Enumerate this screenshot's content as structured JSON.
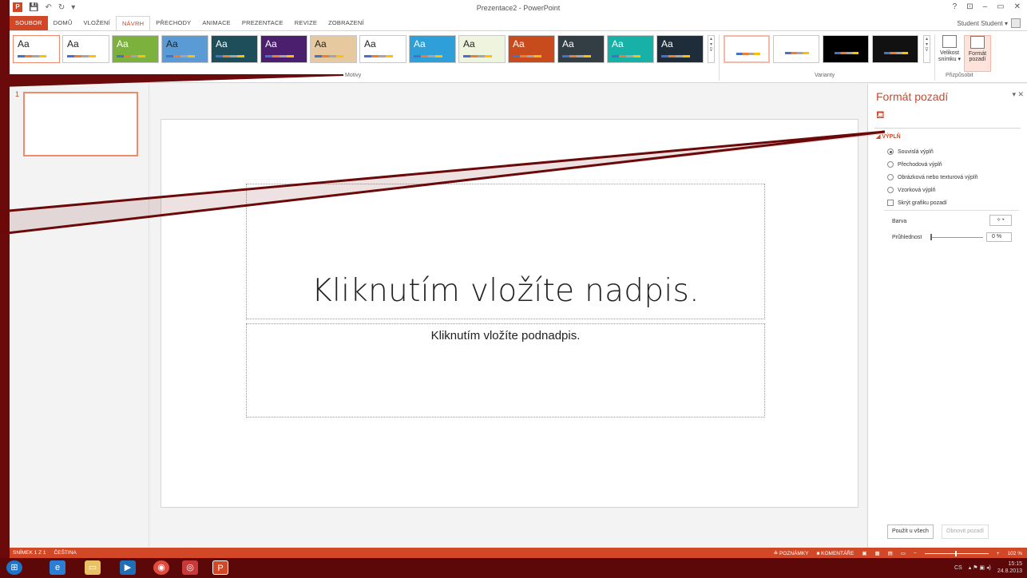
{
  "window": {
    "title": "Prezentace2 - PowerPoint",
    "controls": [
      "?",
      "⊡",
      "–",
      "▭",
      "✕"
    ],
    "qat": [
      "💾",
      "↶",
      "↻",
      "▾"
    ]
  },
  "tabs": [
    {
      "label": "SOUBOR"
    },
    {
      "label": "DOMŮ"
    },
    {
      "label": "VLOŽENÍ"
    },
    {
      "label": "NÁVRH"
    },
    {
      "label": "PŘECHODY"
    },
    {
      "label": "ANIMACE"
    },
    {
      "label": "PREZENTACE"
    },
    {
      "label": "REVIZE"
    },
    {
      "label": "ZOBRAZENÍ"
    }
  ],
  "user": {
    "name": "Student Student ▾"
  },
  "ribbon": {
    "themes_label": "Motivy",
    "variants_label": "Varianty",
    "customize_label": "Přizpůsobit",
    "themes": [
      {
        "aa": "Aa",
        "bg": "#ffffff",
        "fg": "#222222",
        "sel": true
      },
      {
        "aa": "Aa",
        "bg": "#ffffff",
        "fg": "#222222"
      },
      {
        "aa": "Aa",
        "bg": "#7bb13c",
        "fg": "#ffffff"
      },
      {
        "aa": "Aa",
        "bg": "#5b9bd5",
        "fg": "#222222"
      },
      {
        "aa": "Aa",
        "bg": "#1e4e5a",
        "fg": "#ffffff"
      },
      {
        "aa": "Aa",
        "bg": "#4b1f6e",
        "fg": "#ffffff"
      },
      {
        "aa": "Aa",
        "bg": "#e7c9a0",
        "fg": "#222222"
      },
      {
        "aa": "Aa",
        "bg": "#ffffff",
        "fg": "#222222"
      },
      {
        "aa": "Aa",
        "bg": "#2e9fd8",
        "fg": "#ffffff"
      },
      {
        "aa": "Aa",
        "bg": "#eef4de",
        "fg": "#222222"
      },
      {
        "aa": "Aa",
        "bg": "#c84b1e",
        "fg": "#ffffff"
      },
      {
        "aa": "Aa",
        "bg": "#333d44",
        "fg": "#ffffff"
      },
      {
        "aa": "Aa",
        "bg": "#17b1a8",
        "fg": "#ffffff"
      },
      {
        "aa": "Aa",
        "bg": "#1f2d3a",
        "fg": "#ffffff"
      }
    ],
    "variants": [
      {
        "bg": "#ffffff",
        "sel": true
      },
      {
        "bg": "#ffffff"
      },
      {
        "bg": "#000000"
      },
      {
        "bg": "#111111"
      }
    ],
    "slide_size": {
      "line1": "Velikost",
      "line2": "snímku ▾"
    },
    "format_bg": {
      "line1": "Formát",
      "line2": "pozadí"
    }
  },
  "thumbs": {
    "number": "1"
  },
  "slide": {
    "title_placeholder": "Kliknutím vložíte nadpis.",
    "subtitle_placeholder": "Kliknutím vložíte podnadpis."
  },
  "pane": {
    "title": "Formát pozadí",
    "ctrl": "▾ ✕",
    "section": "◢ VÝPLŇ",
    "options": [
      {
        "label": "Souvislá výplň",
        "checked": true
      },
      {
        "label": "Přechodová výplň",
        "checked": false
      },
      {
        "label": "Obrázková nebo texturová výplň",
        "checked": false
      },
      {
        "label": "Vzorková výplň",
        "checked": false
      }
    ],
    "hide_graphics": "Skrýt grafiku pozadí",
    "color_label": "Barva",
    "color_btn": "⟡ ▾",
    "transparency_label": "Průhlednost",
    "transparency_value": "0 %",
    "apply_all": "Použít u všech",
    "reset": "Obnovit pozadí"
  },
  "status": {
    "slide": "SNÍMEK 1 Z 1",
    "lang": "ČEŠTINA",
    "notes": "≙ POZNÁMKY",
    "comments": "■ KOMENTÁŘE",
    "zoom": "102 %"
  },
  "taskbar": {
    "lang": "CS",
    "time": "15:15",
    "date": "24.8.2013"
  },
  "colors": {
    "accent": "#d24726",
    "frame": "#6b0a0a",
    "callout": "#6b0a0a"
  }
}
